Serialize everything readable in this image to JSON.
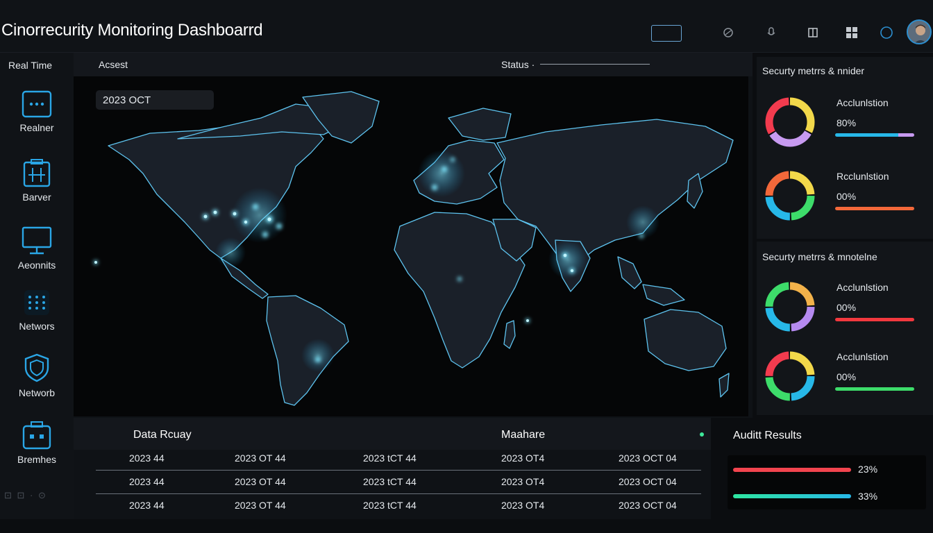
{
  "header": {
    "title": "Cinorrecurity Monitoring Dashboarrd",
    "icons": [
      "globe-icon",
      "microphone-icon",
      "columns-icon",
      "grid-icon",
      "circle-icon"
    ],
    "accent": "#2c8fd0"
  },
  "sidebar": {
    "top_label": "Real Time",
    "items": [
      {
        "label": "Realner",
        "icon": "monitor-dots-icon"
      },
      {
        "label": "Barver",
        "icon": "server-icon"
      },
      {
        "label": "Aeonnits",
        "icon": "display-icon"
      },
      {
        "label": "Networs",
        "icon": "dot-grid-icon"
      },
      {
        "label": "Networb",
        "icon": "shield-icon"
      },
      {
        "label": "Bremhes",
        "icon": "case-icon"
      }
    ],
    "bottom_label": "⊡ ⊡ · ⊙"
  },
  "map": {
    "access_label": "Acsest",
    "status_label": "Status ·",
    "date_chip": "2023 OCT",
    "accent": "#3ad0ff"
  },
  "right_panel": {
    "section1_title": "Securty metrrs & nnider",
    "section2_title": "Securty metrrs & mnotelne",
    "metrics": [
      {
        "label": "Acclunlstion",
        "value": "80%",
        "bar_color": "#27b8e8",
        "bar_fill": 0.8,
        "colors": [
          "#f2d84a",
          "#c79af0",
          "#f23b4e"
        ]
      },
      {
        "label": "Rcclunlstion",
        "value": "00%",
        "bar_color": "#f2683a",
        "bar_fill": 1.0,
        "colors": [
          "#f2d84a",
          "#3ddc6a",
          "#27b8e8",
          "#f2683a"
        ]
      },
      {
        "label": "Acclunlstion",
        "value": "00%",
        "bar_color": "#f2383e",
        "bar_fill": 1.0,
        "colors": [
          "#f2b24a",
          "#b58af0",
          "#27b8e8",
          "#3ddc6a"
        ]
      },
      {
        "label": "Acclunlstion",
        "value": "00%",
        "bar_color": "#3ddc6a",
        "bar_fill": 1.0,
        "colors": [
          "#f2d84a",
          "#27b8e8",
          "#3ddc6a",
          "#f23b4e"
        ]
      }
    ]
  },
  "table": {
    "col_title_1": "Data Rcuay",
    "col_title_2": "Maahare",
    "rows": [
      [
        "2023 44",
        "2023 OT 44",
        "2023 tCT 44",
        "2023 OT4",
        "2023 OCT 04"
      ],
      [
        "2023 44",
        "2023 OT 44",
        "2023 tCT 44",
        "2023 OT4",
        "2023 OCT 04"
      ],
      [
        "2023 44",
        "2023 OT 44",
        "2023 tCT 44",
        "2023 OT4",
        "2023 OCT 04"
      ]
    ]
  },
  "audit": {
    "title": "Auditt Results",
    "bars": [
      {
        "value": "23%",
        "color": "#f2444e"
      },
      {
        "value": "33%",
        "color": "#2ee6a0",
        "color2": "#27b8e8"
      }
    ]
  }
}
